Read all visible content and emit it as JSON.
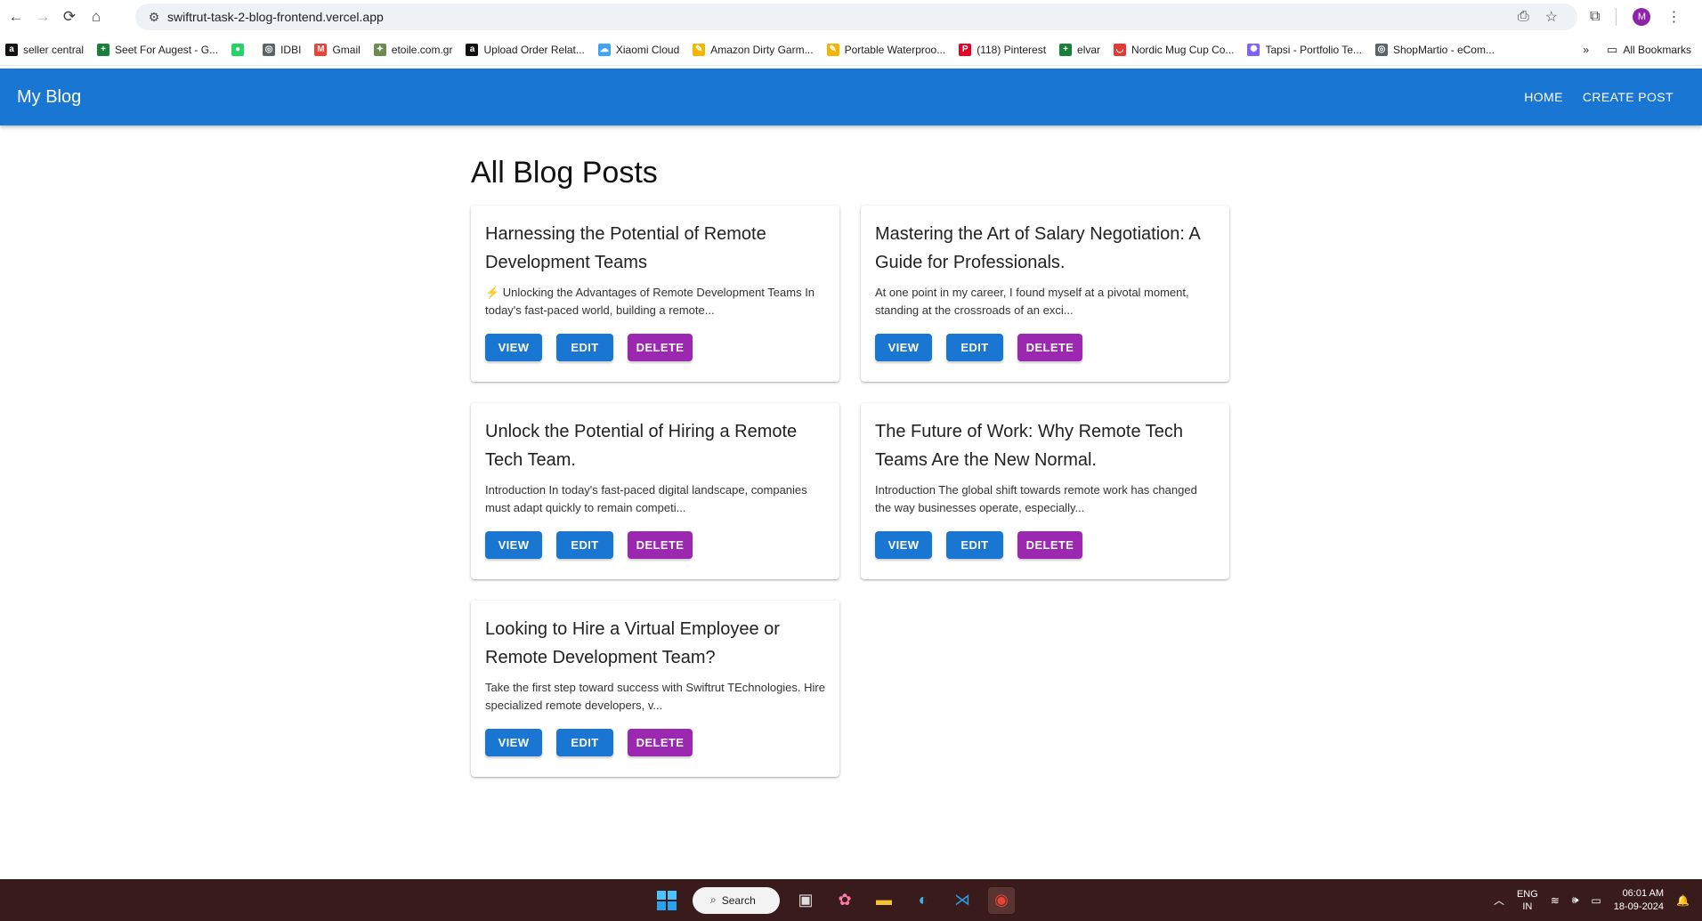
{
  "browser": {
    "url": "swiftrut-task-2-blog-frontend.vercel.app",
    "profile_initial": "M"
  },
  "bookmarks": [
    {
      "label": "seller central",
      "icon": "amazon-icon",
      "color": "#111111",
      "glyph": "a"
    },
    {
      "label": "Seet For Augest - G...",
      "icon": "sheets-icon",
      "color": "#188038",
      "glyph": "+"
    },
    {
      "label": "",
      "icon": "whatsapp-icon",
      "color": "#25d366",
      "glyph": "●"
    },
    {
      "label": "IDBI",
      "icon": "globe-icon",
      "color": "#5f6368",
      "glyph": "◎"
    },
    {
      "label": "Gmail",
      "icon": "gmail-icon",
      "color": "#ea4335",
      "glyph": "M"
    },
    {
      "label": "etoile.com.gr",
      "icon": "etoile-icon",
      "color": "#6d8c52",
      "glyph": "✦"
    },
    {
      "label": "Upload Order Relat...",
      "icon": "amazon-icon",
      "color": "#111111",
      "glyph": "a"
    },
    {
      "label": "Xiaomi Cloud",
      "icon": "cloud-icon",
      "color": "#3da5f4",
      "glyph": "☁"
    },
    {
      "label": "Amazon Dirty Garm...",
      "icon": "slides-icon",
      "color": "#f4b400",
      "glyph": "✎"
    },
    {
      "label": "Portable Waterproo...",
      "icon": "slides-icon",
      "color": "#f4b400",
      "glyph": "✎"
    },
    {
      "label": "(118) Pinterest",
      "icon": "pinterest-icon",
      "color": "#e60023",
      "glyph": "P"
    },
    {
      "label": "elvar",
      "icon": "sheets-icon",
      "color": "#188038",
      "glyph": "+"
    },
    {
      "label": "Nordic Mug Cup Co...",
      "icon": "shop-icon",
      "color": "#e53935",
      "glyph": "◡"
    },
    {
      "label": "Tapsi - Portfolio Te...",
      "icon": "tapsi-icon",
      "color": "#7b61ff",
      "glyph": "✺"
    },
    {
      "label": "ShopMartio - eCom...",
      "icon": "globe-icon",
      "color": "#5f6368",
      "glyph": "◎"
    }
  ],
  "bookmarks_more": "»",
  "all_bookmarks_label": "All Bookmarks",
  "app": {
    "brand": "My Blog",
    "nav": [
      "HOME",
      "CREATE POST"
    ],
    "page_title": "All Blog Posts",
    "button_labels": {
      "view": "VIEW",
      "edit": "EDIT",
      "delete": "DELETE"
    },
    "posts": [
      {
        "title": "Harnessing the Potential of Remote Development Teams",
        "excerpt": "⚡ Unlocking the Advantages of Remote Development Teams In today's fast-paced world, building a remote..."
      },
      {
        "title": "Mastering the Art of Salary Negotiation: A Guide for Professionals.",
        "excerpt": "At one point in my career, I found myself at a pivotal moment, standing at the crossroads of an exci..."
      },
      {
        "title": "Unlock the Potential of Hiring a Remote Tech Team.",
        "excerpt": "Introduction In today's fast-paced digital landscape, companies must adapt quickly to remain competi..."
      },
      {
        "title": "The Future of Work: Why Remote Tech Teams Are the New Normal.",
        "excerpt": "Introduction The global shift towards remote work has changed the way businesses operate, especially..."
      },
      {
        "title": "Looking to Hire a Virtual Employee or Remote Development Team?",
        "excerpt": "Take the first step toward success with Swiftrut TEchnologies. Hire specialized remote developers, v..."
      }
    ]
  },
  "taskbar": {
    "search_label": "Search",
    "lang_top": "ENG",
    "lang_bottom": "IN",
    "time": "06:01 AM",
    "date": "18-09-2024"
  }
}
